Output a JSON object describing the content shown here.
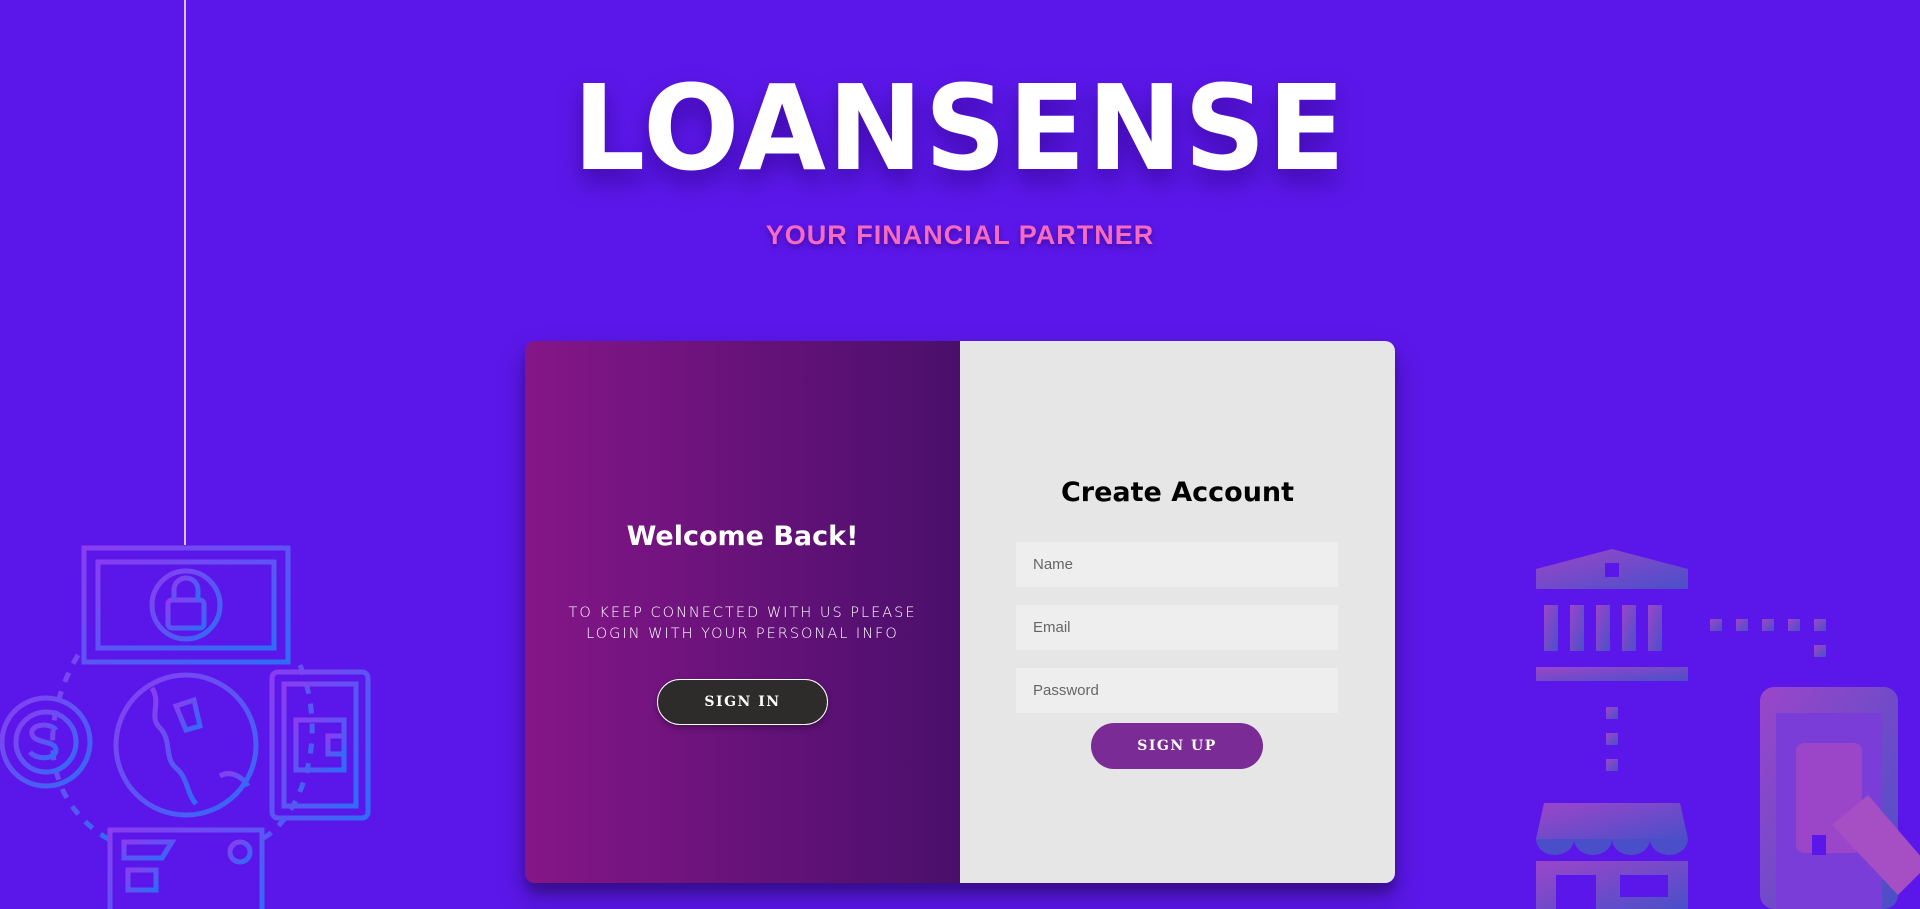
{
  "brand": {
    "name": "LOANSENSE",
    "tagline": "YOUR FINANCIAL PARTNER"
  },
  "signin_panel": {
    "title": "Welcome Back!",
    "text": "TO KEEP CONNECTED WITH US PLEASE LOGIN WITH YOUR PERSONAL INFO",
    "button_label": "SIGN IN"
  },
  "signup_panel": {
    "title": "Create Account",
    "fields": {
      "name_placeholder": "Name",
      "email_placeholder": "Email",
      "password_placeholder": "Password"
    },
    "button_label": "SIGN UP"
  },
  "colors": {
    "background": "#5b17e9",
    "tagline": "#f66bc0",
    "left_panel_start": "#851688",
    "left_panel_end": "#4a0f6b",
    "signup_button": "#7b2b95",
    "signin_button": "#2e2b2b"
  },
  "icons": {
    "left_illustration": [
      "banknote-icon",
      "coin-dollar-icon",
      "globe-icon",
      "wallet-icon",
      "credit-card-icon"
    ],
    "right_illustration": [
      "bank-building-icon",
      "storefront-icon",
      "mobile-payment-icon"
    ]
  }
}
